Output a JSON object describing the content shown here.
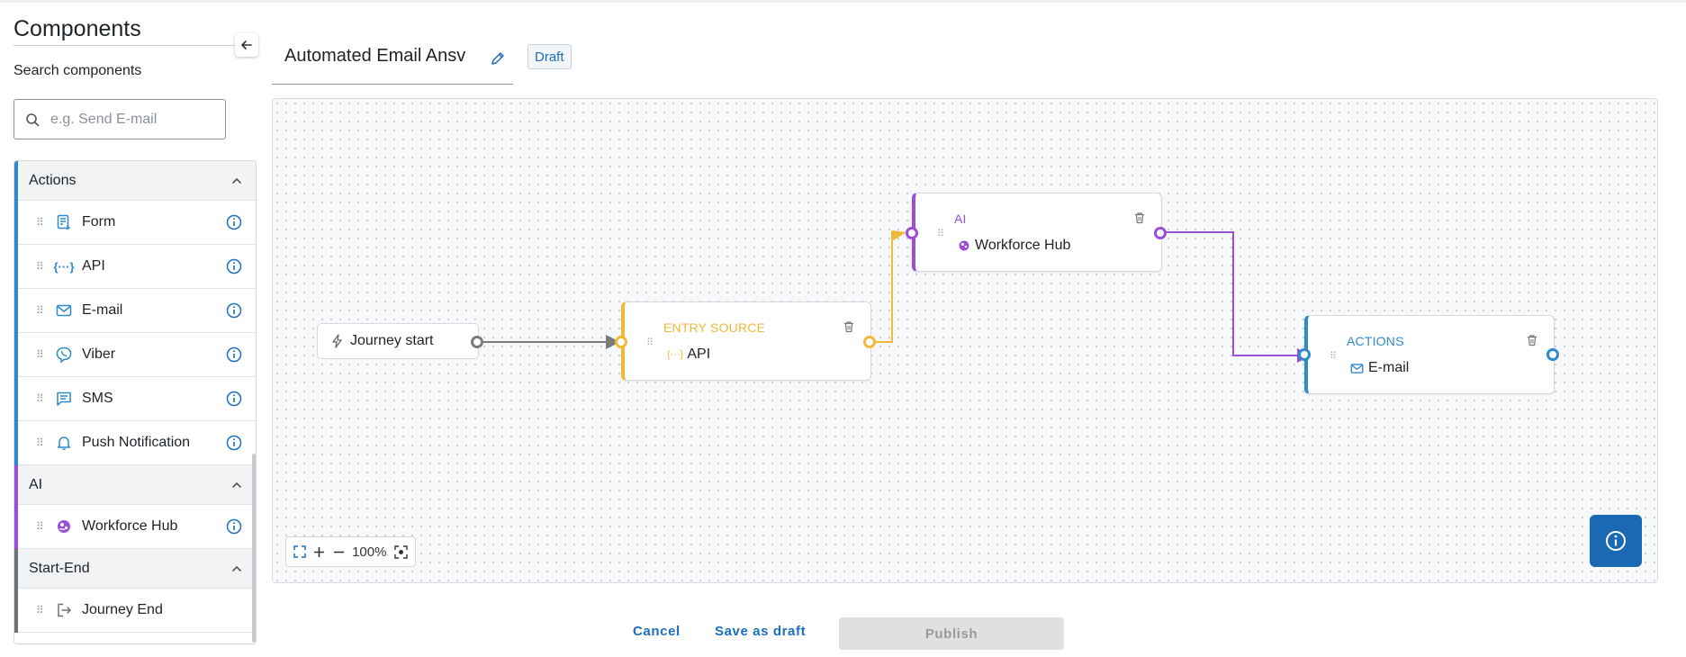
{
  "sidebar": {
    "title": "Components",
    "search_label": "Search components",
    "search_placeholder": "e.g. Send E-mail",
    "groups": [
      {
        "label": "Actions",
        "color": "#2e8bc9",
        "items": [
          {
            "label": "Form",
            "icon": "form-icon"
          },
          {
            "label": "API",
            "icon": "api-icon"
          },
          {
            "label": "E-mail",
            "icon": "email-icon"
          },
          {
            "label": "Viber",
            "icon": "viber-icon"
          },
          {
            "label": "SMS",
            "icon": "sms-icon"
          },
          {
            "label": "Push Notification",
            "icon": "bell-icon"
          }
        ]
      },
      {
        "label": "AI",
        "color": "#9b4fd6",
        "items": [
          {
            "label": "Workforce Hub",
            "icon": "workforce-hub-icon"
          }
        ]
      },
      {
        "label": "Start-End",
        "color": "#6c7178",
        "items": [
          {
            "label": "Journey End",
            "icon": "exit-icon"
          }
        ]
      }
    ]
  },
  "header": {
    "journey_name": "Automated Email Ansv",
    "status_badge": "Draft"
  },
  "canvas": {
    "start_node": {
      "label": "Journey start",
      "icon": "lightning-icon"
    },
    "nodes": [
      {
        "category": "ENTRY SOURCE",
        "label": "API",
        "color": "#f0b93a",
        "icon": "api-icon"
      },
      {
        "category": "AI",
        "label": "Workforce Hub",
        "color": "#9b4fd6",
        "icon": "workforce-hub-icon"
      },
      {
        "category": "ACTIONS",
        "label": "E-mail",
        "color": "#2e8bc9",
        "icon": "email-icon"
      }
    ],
    "zoom_level": "100%"
  },
  "footer": {
    "cancel_label": "Cancel",
    "save_draft_label": "Save as draft",
    "publish_label": "Publish"
  },
  "colors": {
    "primary": "#1b68b3",
    "entry": "#f0b93a",
    "ai": "#9b4fd6",
    "actions": "#2e8bc9"
  }
}
